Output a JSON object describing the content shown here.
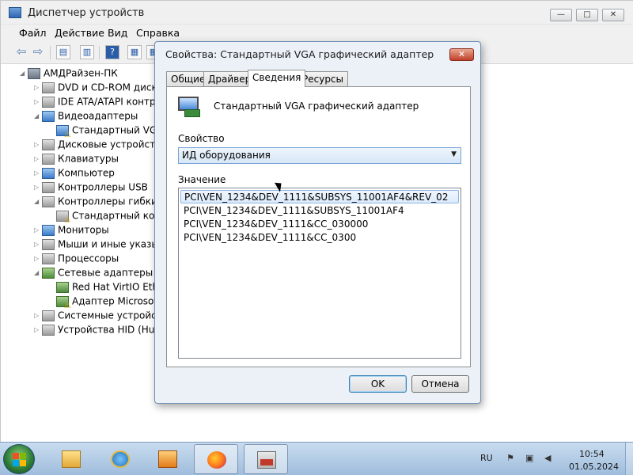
{
  "window": {
    "title": "Диспетчер устройств",
    "controls": {
      "minimize": "—",
      "maximize": "□",
      "close": "✕"
    }
  },
  "menu": [
    "Файл",
    "Действие",
    "Вид",
    "Справка"
  ],
  "toolbar": [
    "back-icon",
    "forward-icon",
    "properties-icon",
    "view-icon",
    "help-icon",
    "scan-icon"
  ],
  "tree": {
    "root": "АМДРайзен-ПК",
    "items": [
      {
        "label": "DVD и CD-ROM диско",
        "icon": "dvd-icon",
        "expanded": false
      },
      {
        "label": "IDE ATA/ATAPI контр",
        "icon": "ide-icon",
        "expanded": false
      },
      {
        "label": "Видеоадаптеры",
        "icon": "display-icon",
        "expanded": true
      },
      {
        "label": "Стандартный VGA",
        "icon": "display-warn-icon",
        "child": true
      },
      {
        "label": "Дисковые устройства",
        "icon": "disk-icon",
        "expanded": false
      },
      {
        "label": "Клавиатуры",
        "icon": "keyboard-icon",
        "expanded": false
      },
      {
        "label": "Компьютер",
        "icon": "computer-icon",
        "expanded": false
      },
      {
        "label": "Контроллеры USB",
        "icon": "usb-icon",
        "expanded": false
      },
      {
        "label": "Контроллеры гибких",
        "icon": "floppy-icon",
        "expanded": true
      },
      {
        "label": "Стандартный конт",
        "icon": "floppy-warn-icon",
        "child": true
      },
      {
        "label": "Мониторы",
        "icon": "monitor-icon",
        "expanded": false
      },
      {
        "label": "Мыши и иные указы",
        "icon": "mouse-icon",
        "expanded": false
      },
      {
        "label": "Процессоры",
        "icon": "cpu-icon",
        "expanded": false
      },
      {
        "label": "Сетевые адаптеры",
        "icon": "network-icon",
        "expanded": true
      },
      {
        "label": "Red Hat VirtIO Ethe",
        "icon": "network-card-icon",
        "child": true
      },
      {
        "label": "Адаптер Microsoft",
        "icon": "network-warn-icon",
        "child": true
      },
      {
        "label": "Системные устройст",
        "icon": "system-icon",
        "expanded": false
      },
      {
        "label": "Устройства HID (Hum",
        "icon": "hid-icon",
        "expanded": false
      }
    ]
  },
  "dialog": {
    "title": "Свойства: Стандартный VGA графический адаптер",
    "close": "✕",
    "tabs": [
      "Общие",
      "Драйвер",
      "Сведения",
      "Ресурсы"
    ],
    "active_tab": "Сведения",
    "device_name": "Стандартный VGA графический адаптер",
    "property_label": "Свойство",
    "property_value": "ИД оборудования",
    "value_label": "Значение",
    "values": [
      "PCI\\VEN_1234&DEV_1111&SUBSYS_11001AF4&REV_02",
      "PCI\\VEN_1234&DEV_1111&SUBSYS_11001AF4",
      "PCI\\VEN_1234&DEV_1111&CC_030000",
      "PCI\\VEN_1234&DEV_1111&CC_0300"
    ],
    "ok": "OK",
    "cancel": "Отмена"
  },
  "taskbar": {
    "items": [
      "explorer-icon",
      "ie-icon",
      "media-player-icon",
      "firefox-icon",
      "device-manager-icon"
    ],
    "lang": "RU",
    "time": "10:54",
    "date": "01.05.2024"
  }
}
